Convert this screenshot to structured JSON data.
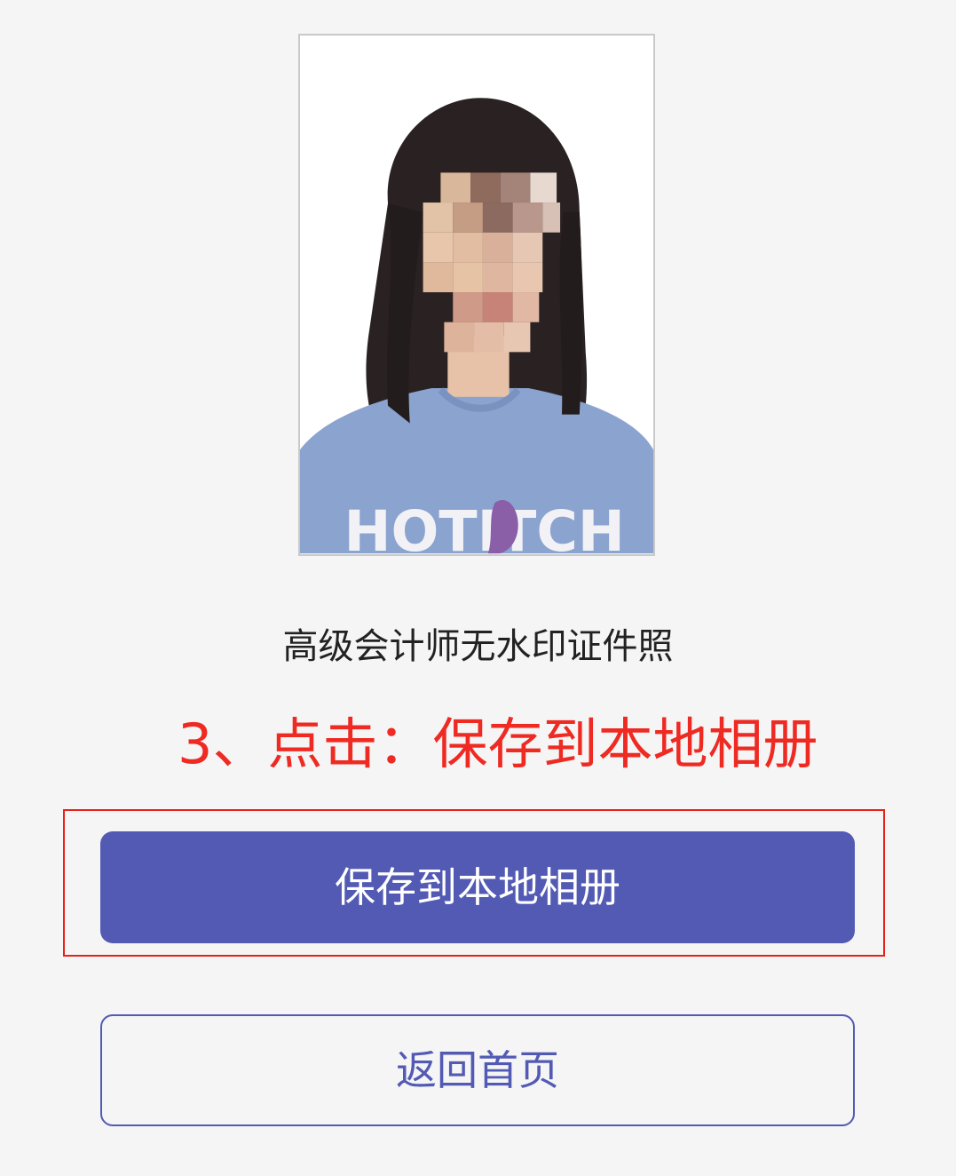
{
  "photo": {
    "shirt_text": "HOTITCH"
  },
  "photo_title": "高级会计师无水印证件照",
  "instruction": "3、点击：保存到本地相册",
  "buttons": {
    "save_label": "保存到本地相册",
    "home_label": "返回首页"
  },
  "colors": {
    "accent": "#525ab4",
    "instruction_red": "#ee2a23",
    "highlight_border": "#e8211b",
    "background": "#f5f5f5"
  }
}
